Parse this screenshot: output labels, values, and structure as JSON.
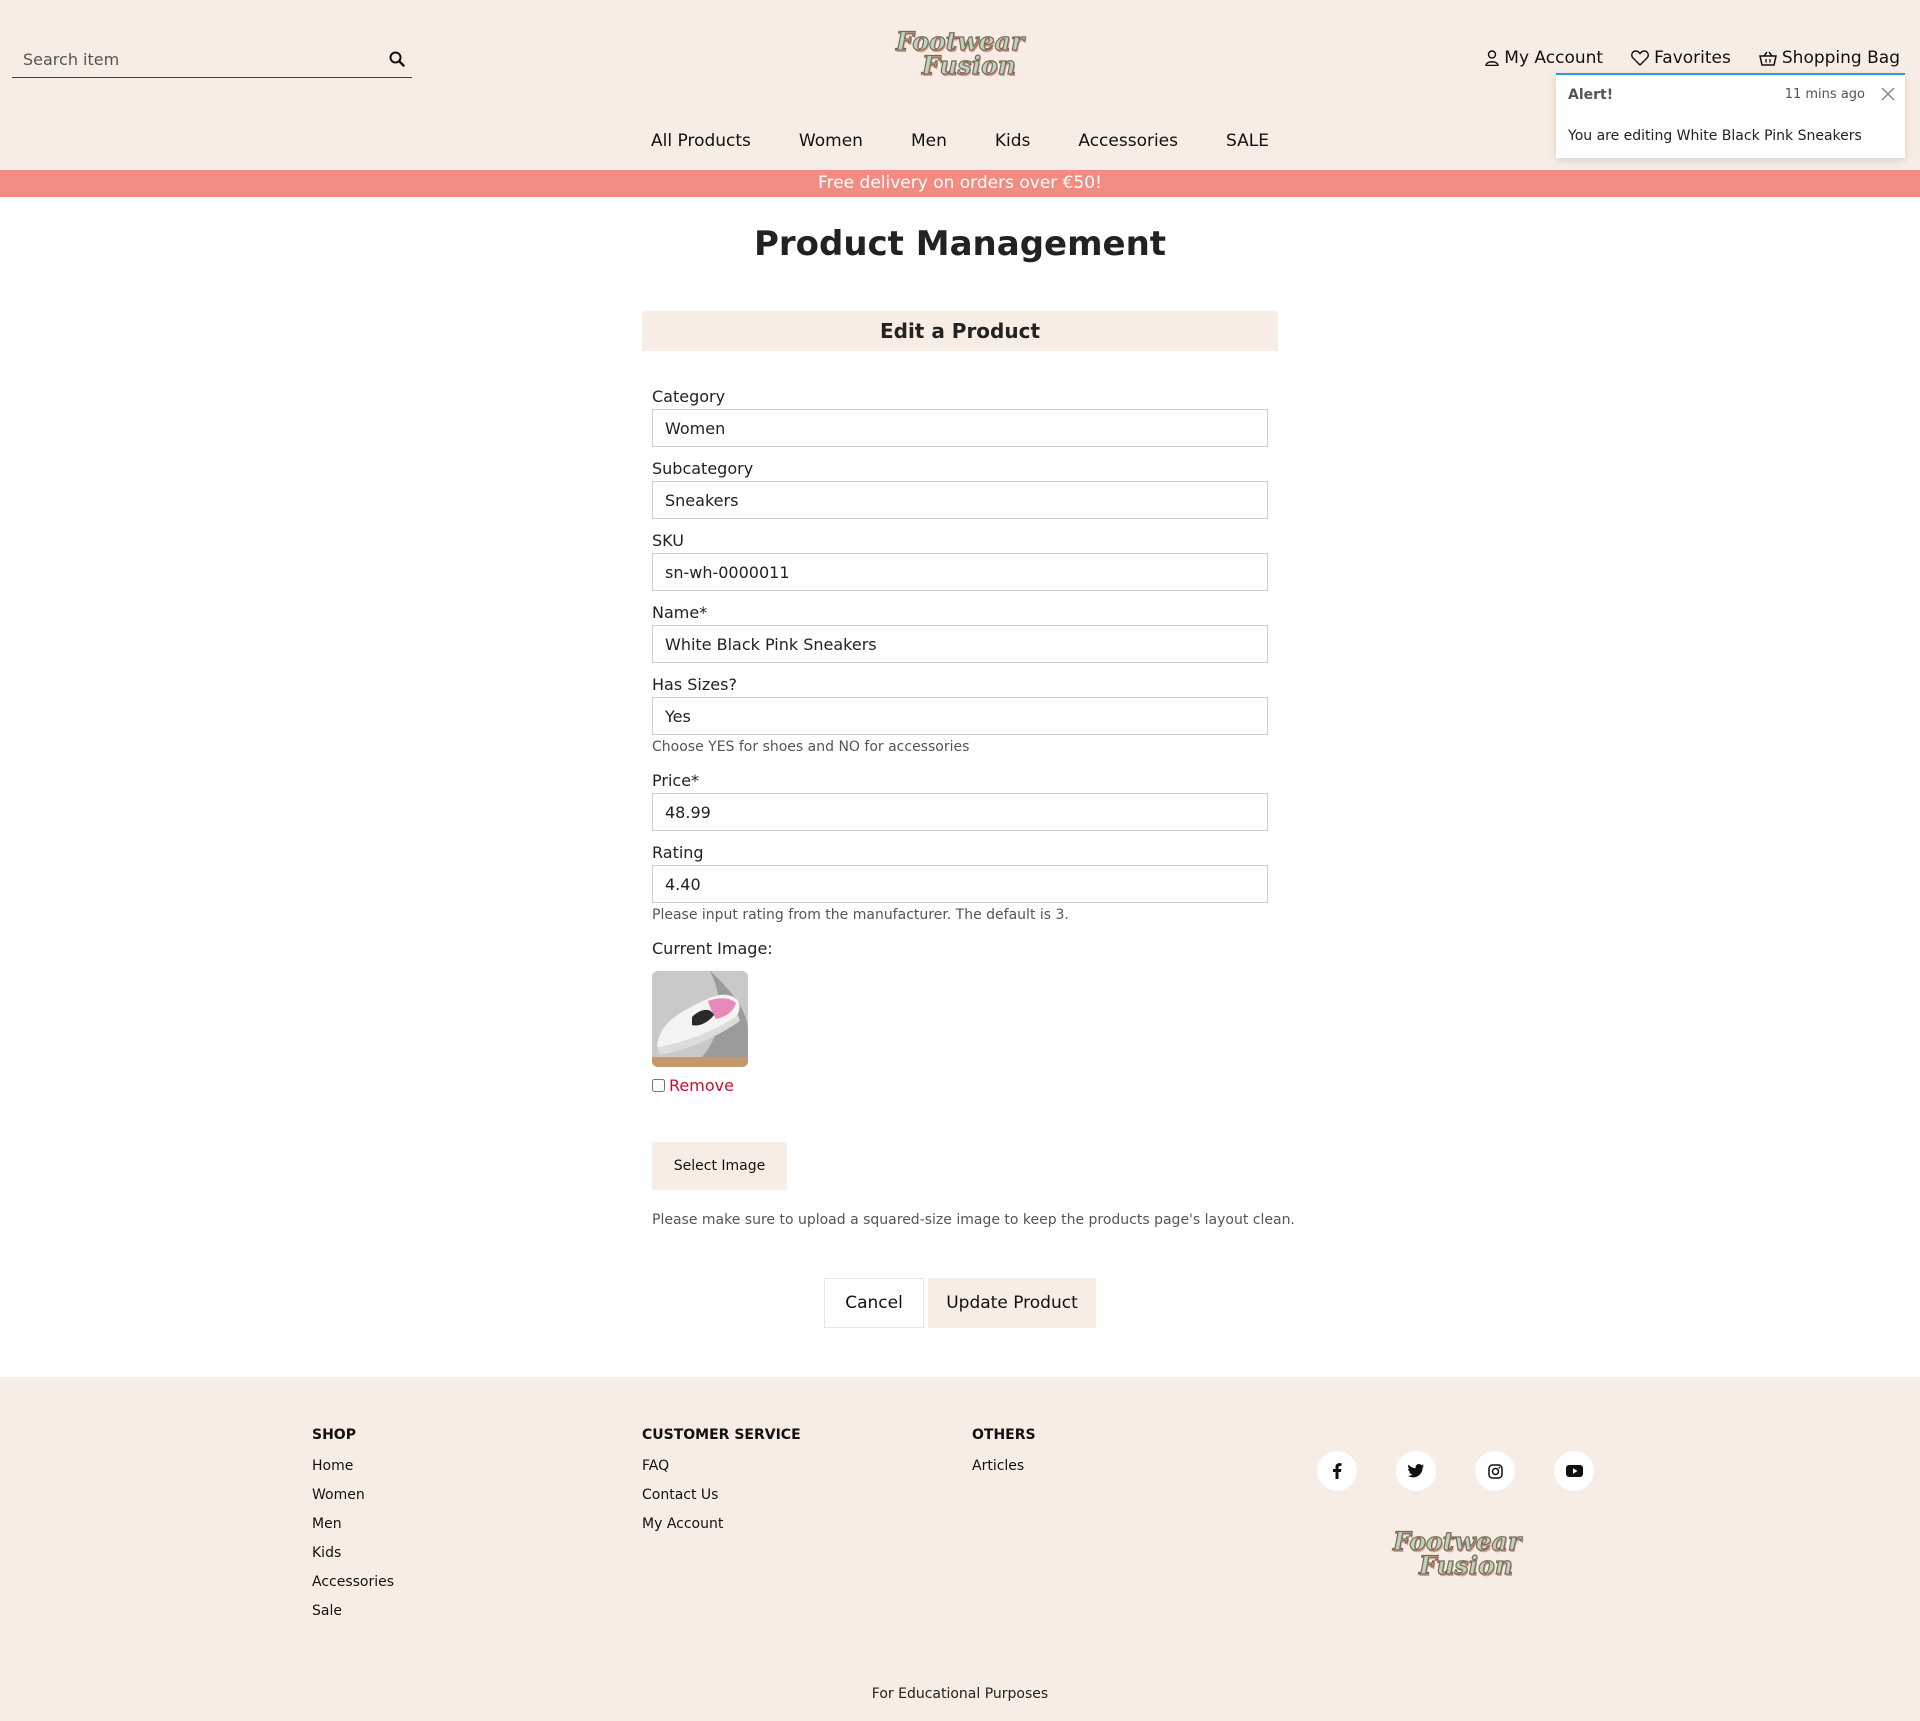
{
  "header": {
    "search_placeholder": "Search item",
    "logo_line1": "Footwear",
    "logo_line2": "Fusion",
    "account": {
      "my_account": "My Account",
      "favorites": "Favorites",
      "shopping_bag": "Shopping Bag"
    },
    "nav": [
      "All Products",
      "Women",
      "Men",
      "Kids",
      "Accessories",
      "SALE"
    ]
  },
  "toast": {
    "title": "Alert!",
    "time": "11 mins ago",
    "message": "You are editing White Black Pink Sneakers",
    "accent_color": "#2f9fd0"
  },
  "promo": {
    "text": "Free delivery on orders over €50!",
    "color": "#f28b82"
  },
  "page_title": "Product Management",
  "form": {
    "heading": "Edit a Product",
    "fields": {
      "category": {
        "label": "Category",
        "value": "Women"
      },
      "subcategory": {
        "label": "Subcategory",
        "value": "Sneakers"
      },
      "sku": {
        "label": "SKU",
        "value": "sn-wh-0000011"
      },
      "name": {
        "label": "Name*",
        "value": "White Black Pink Sneakers"
      },
      "has_sizes": {
        "label": "Has Sizes?",
        "value": "Yes",
        "help": "Choose YES for shoes and NO for accessories"
      },
      "price": {
        "label": "Price*",
        "value": "48.99"
      },
      "rating": {
        "label": "Rating",
        "value": "4.40",
        "help": "Please input rating from the manufacturer. The default is 3."
      }
    },
    "current_image_label": "Current Image:",
    "remove_label": "Remove",
    "select_image_label": "Select Image",
    "image_help": "Please make sure to upload a squared-size image to keep the products page's layout clean.",
    "cancel_label": "Cancel",
    "submit_label": "Update Product"
  },
  "footer": {
    "shop": {
      "heading": "SHOP",
      "links": [
        "Home",
        "Women",
        "Men",
        "Kids",
        "Accessories",
        "Sale"
      ]
    },
    "customer_service": {
      "heading": "CUSTOMER SERVICE",
      "links": [
        "FAQ",
        "Contact Us",
        "My Account"
      ]
    },
    "others": {
      "heading": "OTHERS",
      "links": [
        "Articles"
      ]
    },
    "social_icons": [
      "facebook-icon",
      "twitter-icon",
      "instagram-icon",
      "youtube-icon"
    ],
    "note": "For Educational Purposes"
  },
  "colors": {
    "cream": "#f7ede4",
    "danger": "#c8102e"
  }
}
